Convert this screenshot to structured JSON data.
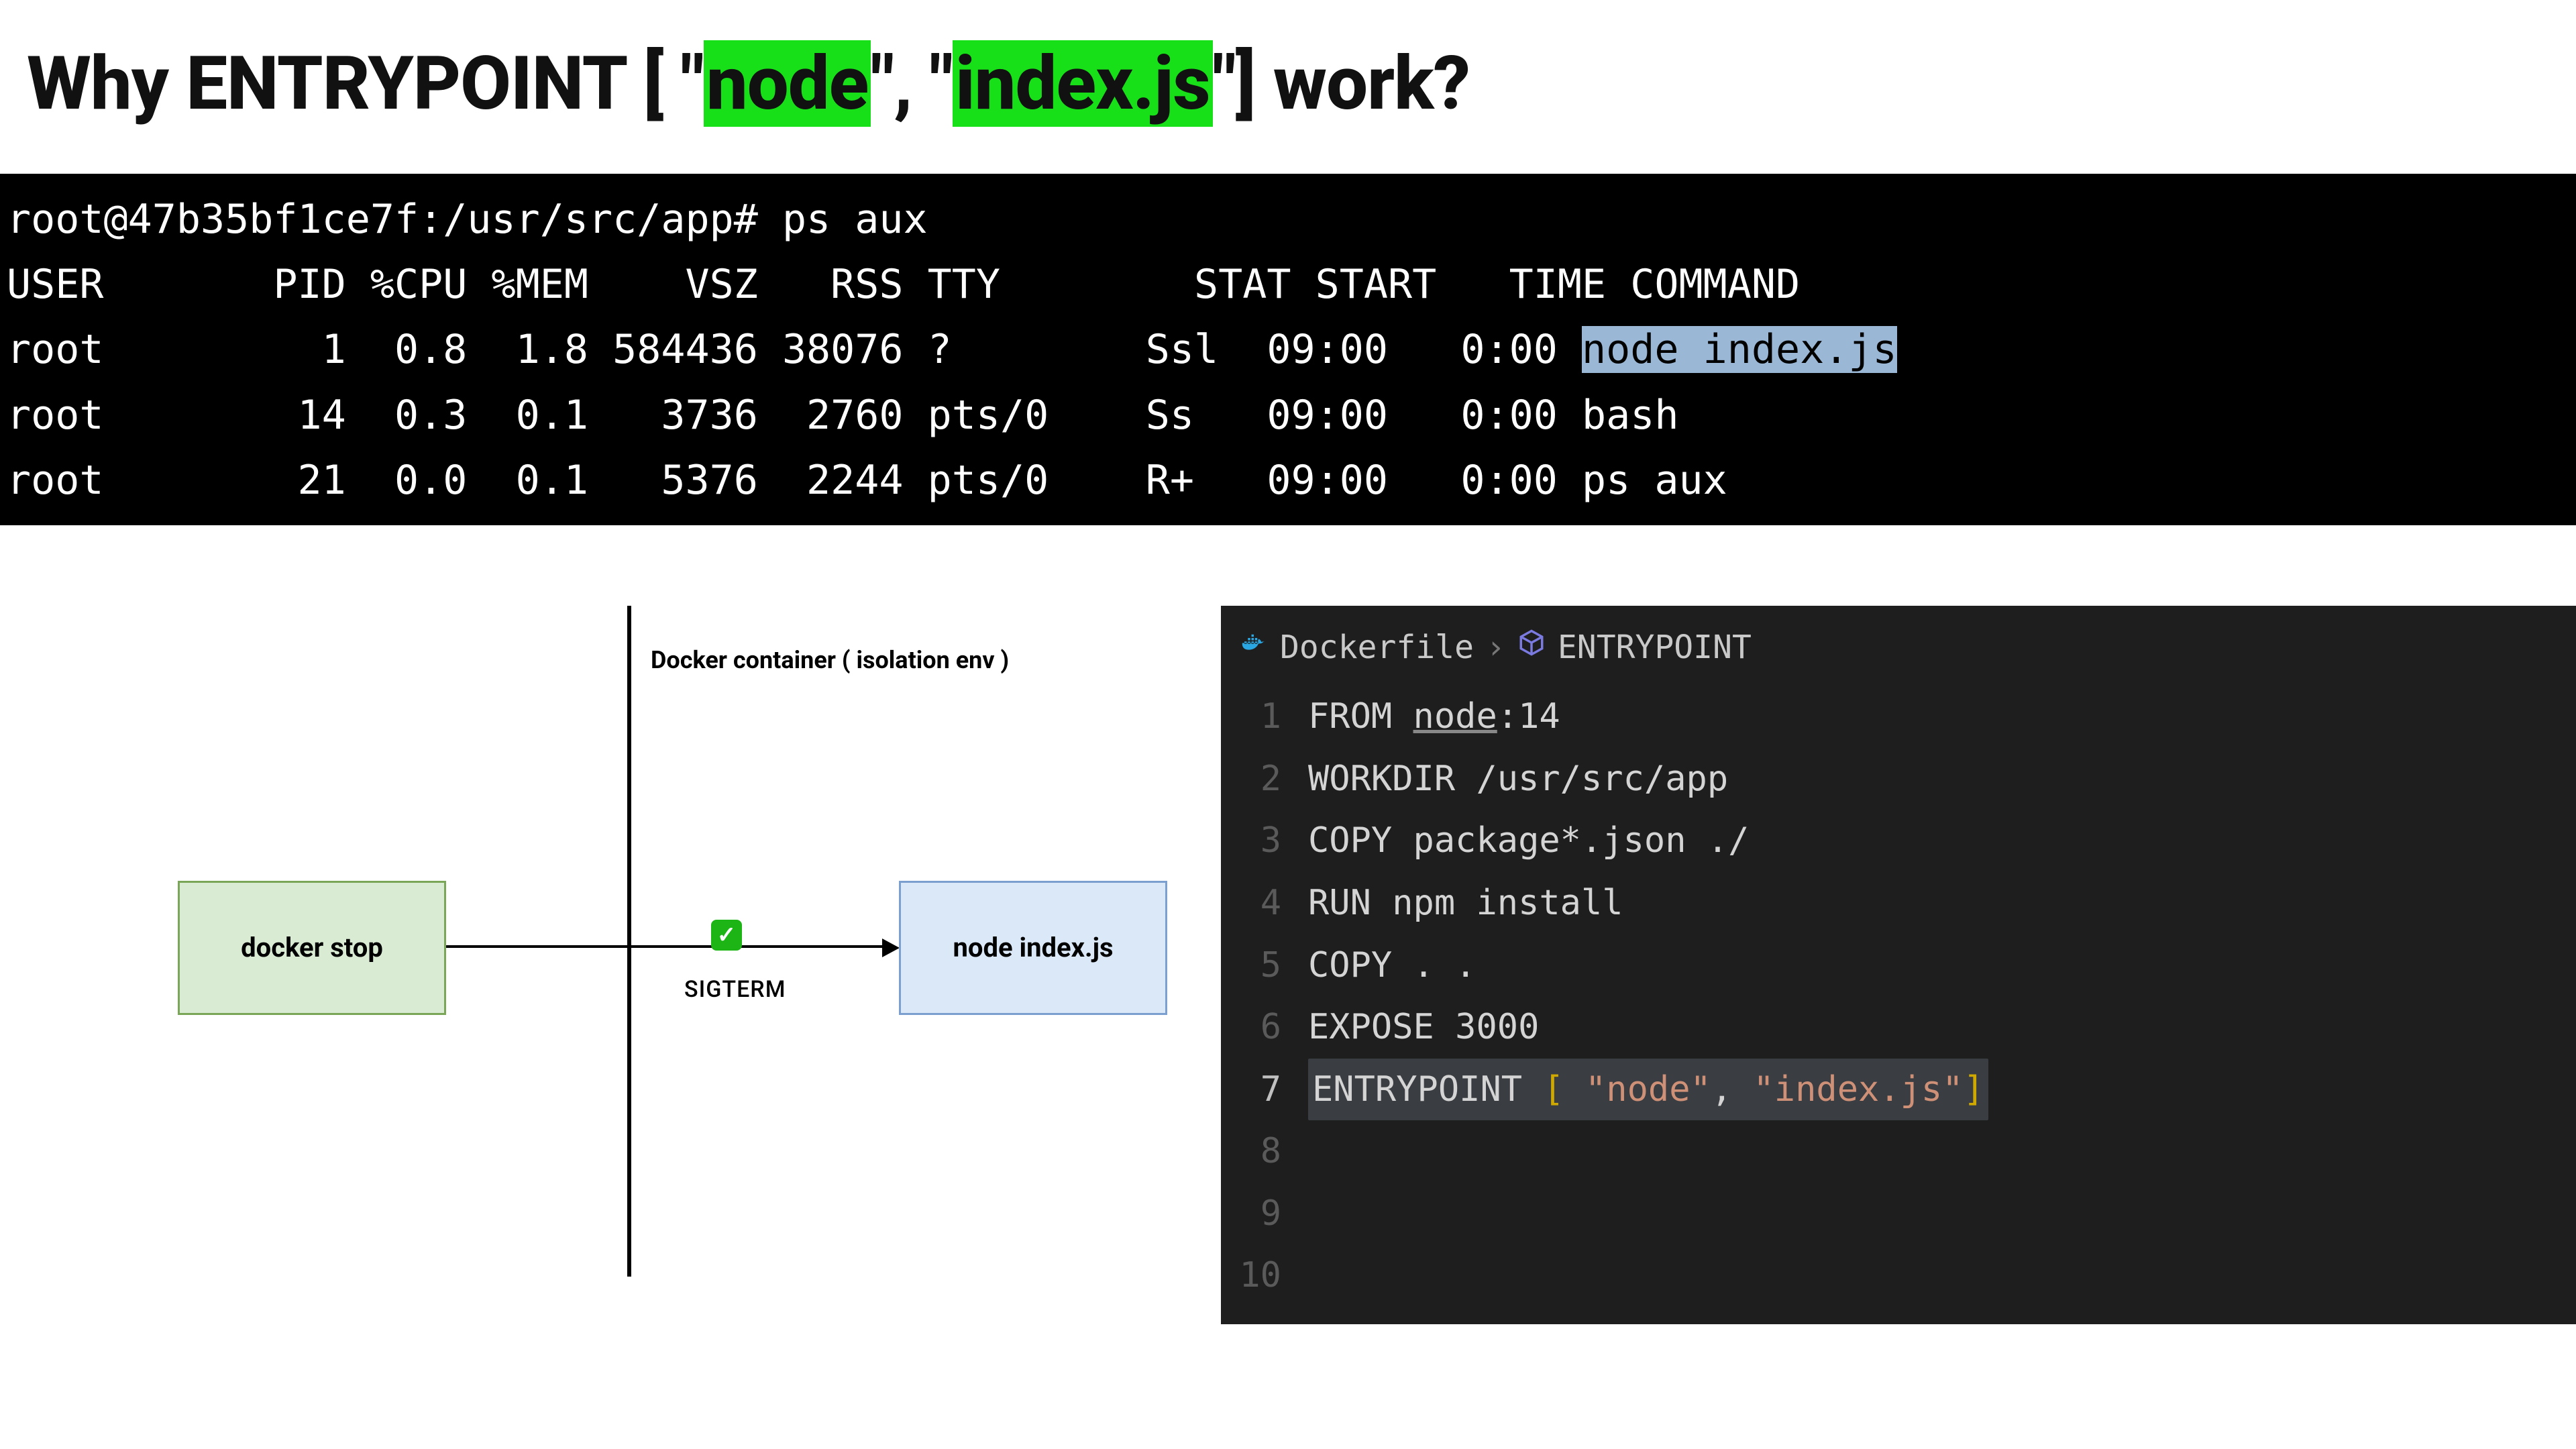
{
  "title": {
    "pre": "Why ENTRYPOINT [ \"",
    "hl1": "node",
    "mid": "\", \"",
    "hl2": "index.js",
    "post": "\"] work?"
  },
  "terminal": {
    "prompt": "root@47b35bf1ce7f:/usr/src/app# ps aux",
    "header": "USER       PID %CPU %MEM    VSZ   RSS TTY        STAT START   TIME COMMAND",
    "rows": [
      {
        "pre": "root         1  0.8  1.8 584436 38076 ?        Ssl  09:00   0:00 ",
        "sel": "node index.js",
        "post": ""
      },
      {
        "pre": "root        14  0.3  0.1   3736  2760 pts/0    Ss   09:00   0:00 bash",
        "sel": "",
        "post": ""
      },
      {
        "pre": "root        21  0.0  0.1   5376  2244 pts/0    R+   09:00   0:00 ps aux",
        "sel": "",
        "post": ""
      }
    ]
  },
  "diagram": {
    "container_label": "Docker container ( isolation env )",
    "left_box": "docker stop",
    "right_box": "node index.js",
    "signal": "SIGTERM",
    "check": "✓"
  },
  "editor": {
    "breadcrumb": {
      "file": "Dockerfile",
      "section": "ENTRYPOINT"
    },
    "lines": [
      {
        "n": "1",
        "parts": [
          {
            "t": "FROM ",
            "c": "kw"
          },
          {
            "t": "node",
            "c": "under"
          },
          {
            "t": ":14",
            "c": "kw"
          }
        ]
      },
      {
        "n": "2",
        "parts": [
          {
            "t": "WORKDIR /usr/src/app",
            "c": "kw"
          }
        ]
      },
      {
        "n": "3",
        "parts": [
          {
            "t": "COPY package*.json ./",
            "c": "kw"
          }
        ]
      },
      {
        "n": "4",
        "parts": [
          {
            "t": "RUN npm install",
            "c": "kw"
          }
        ]
      },
      {
        "n": "5",
        "parts": [
          {
            "t": "COPY . .",
            "c": "kw"
          }
        ]
      },
      {
        "n": "6",
        "parts": [
          {
            "t": "EXPOSE 3000",
            "c": "kw"
          }
        ]
      },
      {
        "n": "7",
        "hl": true,
        "parts": [
          {
            "t": "ENTRYPOINT ",
            "c": "kw"
          },
          {
            "t": "[",
            "c": "brk"
          },
          {
            "t": " ",
            "c": "kw"
          },
          {
            "t": "\"node\"",
            "c": "str"
          },
          {
            "t": ", ",
            "c": "kw"
          },
          {
            "t": "\"index.js\"",
            "c": "str"
          },
          {
            "t": "]",
            "c": "brk"
          }
        ]
      },
      {
        "n": "8",
        "parts": []
      },
      {
        "n": "9",
        "parts": []
      },
      {
        "n": "10",
        "parts": []
      }
    ]
  }
}
